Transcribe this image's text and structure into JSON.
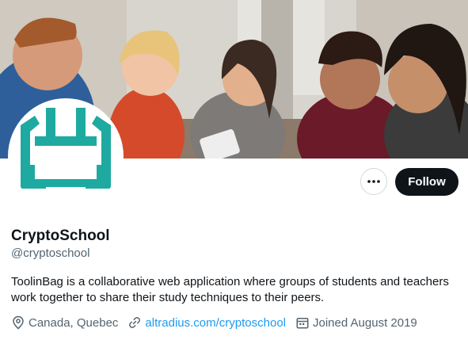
{
  "profile": {
    "name": "CryptoSchool",
    "handle": "@cryptoschool",
    "bio": "ToolinBag is a collaborative web application where groups of students and teachers work together to share their study techniques to their peers.",
    "location": "Canada, Quebec",
    "website": "altradius.com/cryptoschool",
    "joined": "Joined August 2019"
  },
  "actions": {
    "more_label": "•••",
    "follow_label": "Follow"
  },
  "icons": {
    "location": "location-pin-icon",
    "link": "link-icon",
    "calendar": "calendar-icon",
    "more": "more-icon"
  },
  "colors": {
    "accent": "#1d9bf0",
    "logo": "#1eaaa0",
    "follow_bg": "#0f1419",
    "muted": "#536471"
  }
}
